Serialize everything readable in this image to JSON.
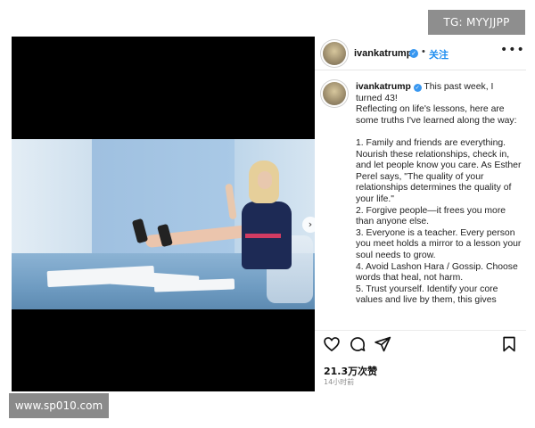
{
  "watermarks": {
    "top": "TG: MYYJJPP",
    "bottom": "www.sp010.com"
  },
  "post": {
    "username": "ivankatrump",
    "follow_label": "关注",
    "separator": "•",
    "more_label": "•••",
    "caption_intro": "This past week, I turned 43!",
    "caption_body": "\nReflecting on life's lessons, here are some truths I've learned along the way:\n\n1. Family and friends are everything. Nourish these relationships, check in, and let people know you care. As Esther Perel says, \"The quality of your relationships determines the quality of your life.\"\n2. Forgive people—it frees you more than anyone else.\n3. Everyone is a teacher. Every person you meet holds a mirror to a lesson your soul needs to grow.\n4. Avoid Lashon Hara / Gossip. Choose words that heal, not harm.\n5. Trust yourself. Identify your core values and live by them, this gives",
    "likes": "21.3万次赞",
    "time": "14小时前"
  },
  "icons": {
    "like": "heart-icon",
    "comment": "comment-icon",
    "share": "send-icon",
    "save": "bookmark-icon",
    "verified": "verified-badge-icon",
    "next": "chevron-right-icon"
  },
  "colors": {
    "follow": "#1f8ef0",
    "verified": "#3897f0",
    "watermark": "#8e8e8e"
  }
}
